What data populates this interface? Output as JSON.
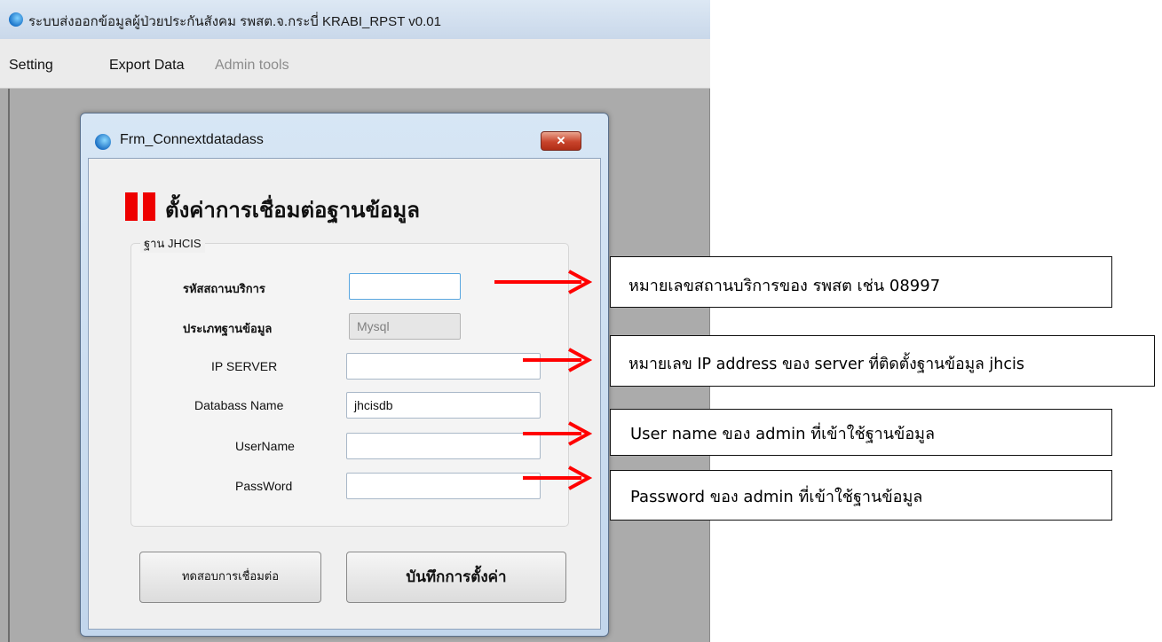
{
  "app": {
    "title": "ระบบส่งออกข้อมูลผู้ป่วยประกันสังคม รพสต.จ.กระบี่ KRABI_RPST v0.01"
  },
  "menu": {
    "items": [
      {
        "label": "Setting",
        "enabled": true
      },
      {
        "label": "Export Data",
        "enabled": true
      },
      {
        "label": "Admin tools",
        "enabled": false
      }
    ]
  },
  "dialog": {
    "title": "Frm_Connextdatadass",
    "close_label": "✕",
    "heading": "ตั้งค่าการเชื่อมต่อฐานข้อมูล",
    "group_label": "ฐาน JHCIS",
    "fields": [
      {
        "label": "รหัสสถานบริการ",
        "value": "",
        "state": "focused"
      },
      {
        "label": "ประเภทฐานข้อมูล",
        "value": "Mysql",
        "state": "disabled"
      },
      {
        "label": "IP SERVER",
        "value": "",
        "state": "normal"
      },
      {
        "label": "Databass Name",
        "value": "jhcisdb",
        "state": "normal"
      },
      {
        "label": "UserName",
        "value": "",
        "state": "normal"
      },
      {
        "label": "PassWord",
        "value": "",
        "state": "normal"
      }
    ],
    "buttons": {
      "test_label": "ทดสอบการเชื่อมต่อ",
      "save_label": "บันทึกการตั้งค่า"
    }
  },
  "annotations": [
    "หมายเลขสถานบริการของ รพสต เช่น 08997",
    "หมายเลข IP address ของ server ที่ติดตั้งฐานข้อมูล jhcis",
    "User name ของ admin ที่เข้าใช้ฐานข้อมูล",
    "Password ของ admin ที่เข้าใช้ฐานข้อมูล"
  ],
  "colors": {
    "accent_red": "#ee0000",
    "arrow_red": "#ff0000"
  }
}
